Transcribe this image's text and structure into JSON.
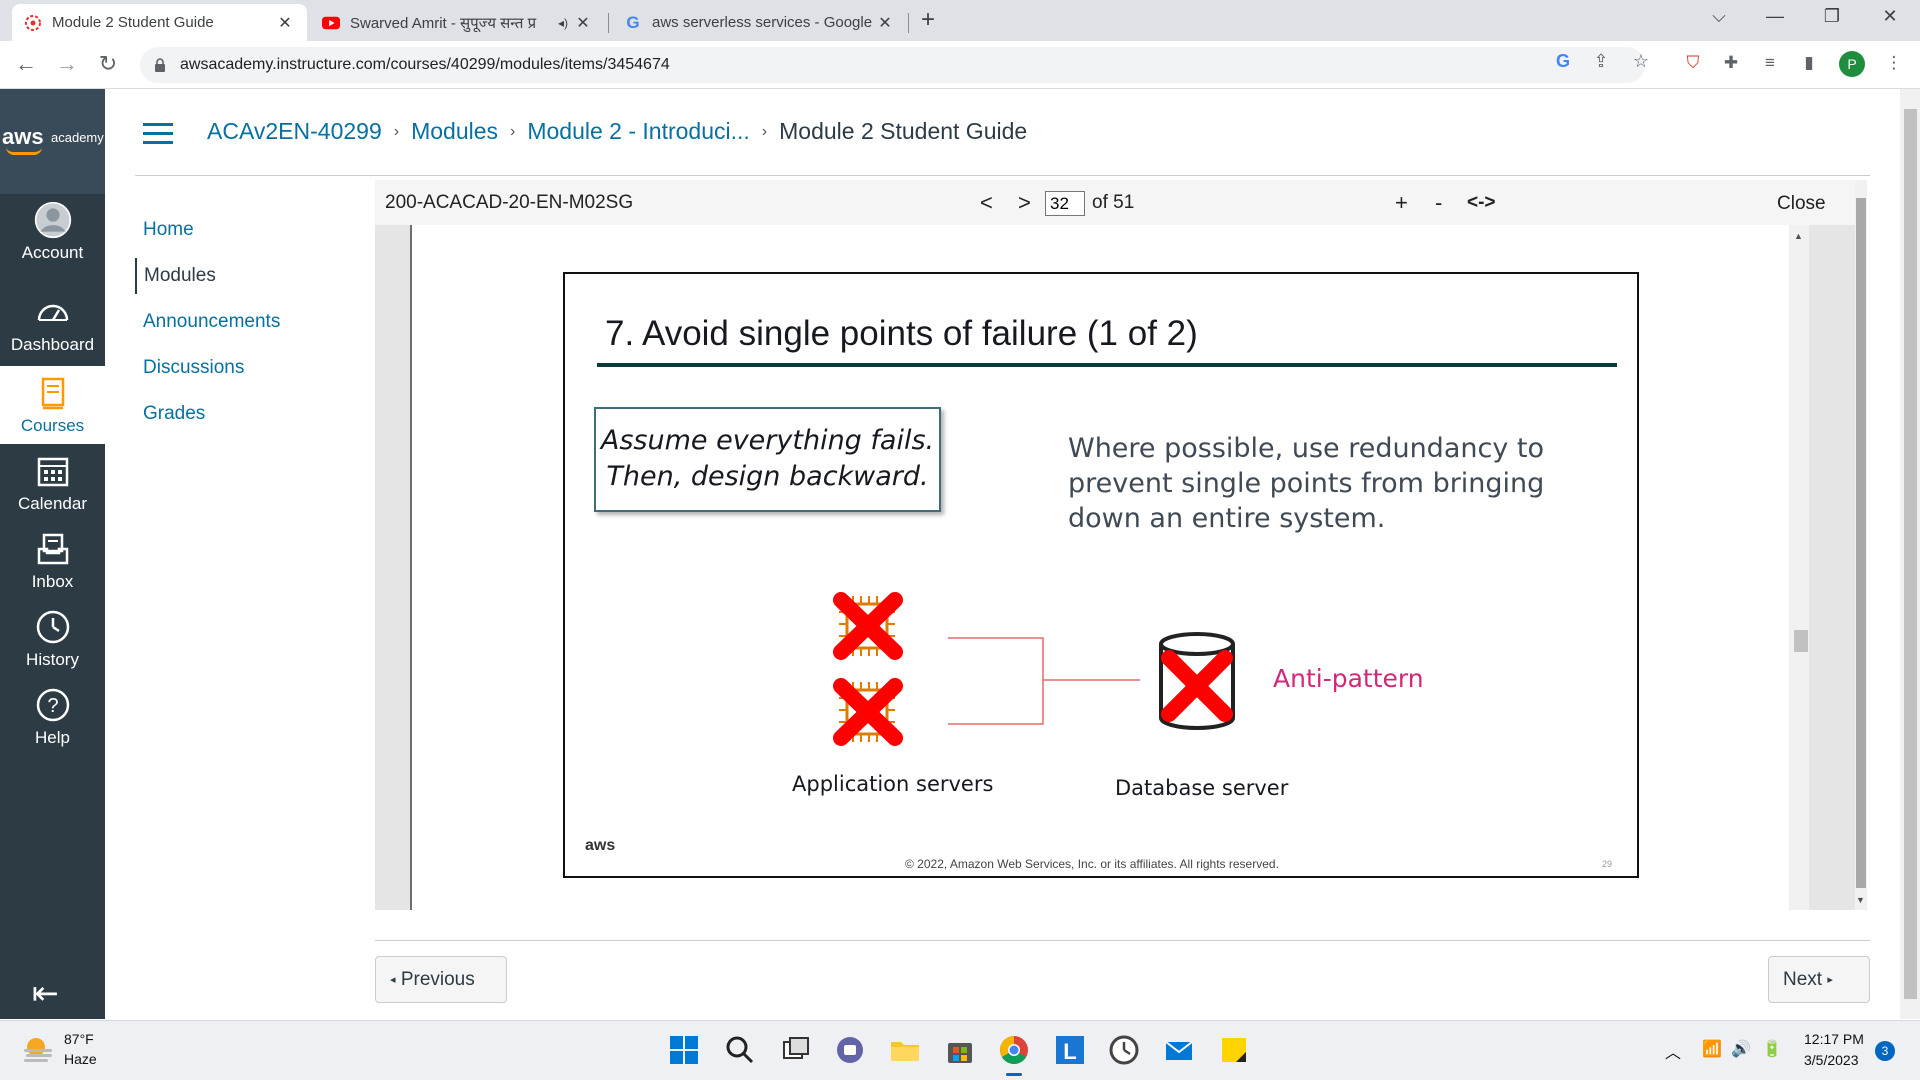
{
  "browser": {
    "tabs": [
      {
        "title": "Module 2 Student Guide",
        "icon": "canvas-icon",
        "active": true
      },
      {
        "title": "Swarved Amrit - सुपूज्य सन्त प्र",
        "icon": "youtube-icon",
        "active": false
      },
      {
        "title": "aws serverless services - Google S",
        "icon": "google-icon",
        "active": false
      }
    ],
    "url": "awsacademy.instructure.com/courses/40299/modules/items/3454674",
    "profile_initial": "P"
  },
  "globalnav": {
    "brand_main": "aws",
    "brand_sub": "academy",
    "items": [
      {
        "label": "Account",
        "icon": "account-avatar-icon"
      },
      {
        "label": "Dashboard",
        "icon": "dashboard-gauge-icon"
      },
      {
        "label": "Courses",
        "icon": "courses-book-icon"
      },
      {
        "label": "Calendar",
        "icon": "calendar-icon"
      },
      {
        "label": "Inbox",
        "icon": "inbox-icon"
      },
      {
        "label": "History",
        "icon": "history-clock-icon"
      },
      {
        "label": "Help",
        "icon": "help-question-icon"
      }
    ]
  },
  "breadcrumb": {
    "course": "ACAv2EN-40299",
    "modules": "Modules",
    "module": "Module 2 - Introduci...",
    "current": "Module 2 Student Guide"
  },
  "coursenav": {
    "items": [
      "Home",
      "Modules",
      "Announcements",
      "Discussions",
      "Grades"
    ],
    "active": "Modules"
  },
  "viewer": {
    "doc_name": "200-ACACAD-20-EN-M02SG",
    "prev": "<",
    "next": ">",
    "page": "32",
    "page_total": "of 51",
    "zoom_in": "+",
    "zoom_out": "-",
    "fit": "<->",
    "close": "Close"
  },
  "slide": {
    "title": "7. Avoid single points of failure (1 of 2)",
    "quote_line1": "Assume everything fails.",
    "quote_line2": "Then, design backward.",
    "body_line1": "Where possible, use redundancy to",
    "body_line2": "prevent single points from bringing",
    "body_line3": "down an entire system.",
    "app_label": "Application servers",
    "db_label": "Database server",
    "anti_label": "Anti-pattern",
    "logo": "aws",
    "copyright": "© 2022, Amazon Web Services, Inc. or its affiliates. All rights reserved.",
    "page_num": "29"
  },
  "pager": {
    "previous": "Previous",
    "next": "Next"
  },
  "taskbar": {
    "temp": "87°F",
    "weather": "Haze",
    "time": "12:17 PM",
    "date": "3/5/2023",
    "notifications": "3"
  },
  "colors": {
    "canvas_nav": "#2d3b45",
    "link_blue": "#0770a3",
    "slide_rule": "#0c3b3b",
    "anti_pattern": "#d1287a",
    "failure_x": "#ff0000"
  }
}
